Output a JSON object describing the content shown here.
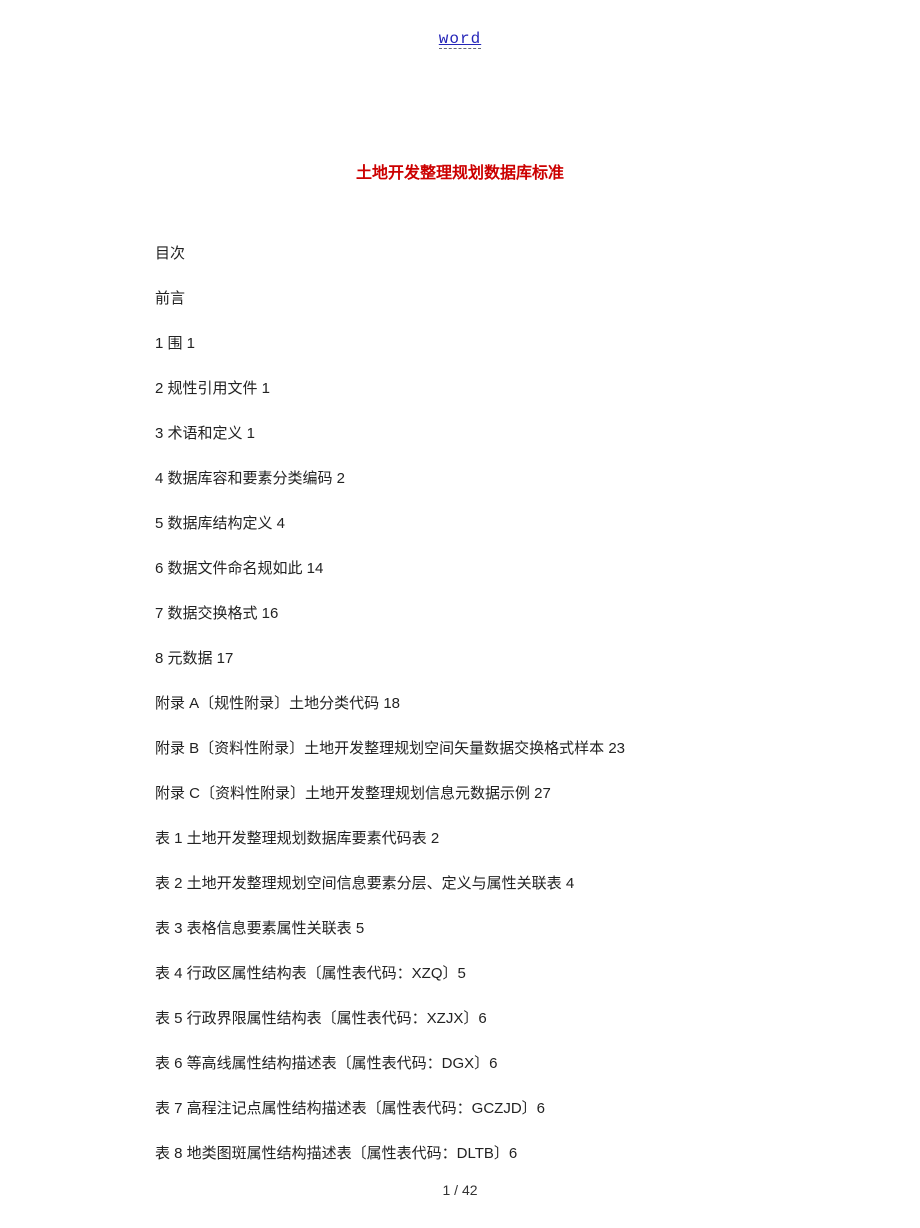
{
  "header": {
    "link": "word"
  },
  "title": "土地开发整理规划数据库标准",
  "toc": [
    "目次",
    "前言",
    "1 围 1",
    "2 规性引用文件 1",
    "3 术语和定义 1",
    "4 数据库容和要素分类编码 2",
    "5 数据库结构定义 4",
    "6 数据文件命名规如此 14",
    "7 数据交换格式 16",
    "8 元数据 17",
    "附录 A〔规性附录〕土地分类代码 18",
    "附录 B〔资料性附录〕土地开发整理规划空间矢量数据交换格式样本 23",
    "附录 C〔资料性附录〕土地开发整理规划信息元数据示例 27",
    "表 1 土地开发整理规划数据库要素代码表 2",
    "表 2 土地开发整理规划空间信息要素分层、定义与属性关联表 4",
    "表 3 表格信息要素属性关联表 5",
    "表 4 行政区属性结构表〔属性表代码：XZQ〕5",
    "表 5 行政界限属性结构表〔属性表代码：XZJX〕6",
    "表 6 等高线属性结构描述表〔属性表代码：DGX〕6",
    "表 7 高程注记点属性结构描述表〔属性表代码：GCZJD〕6",
    "表 8 地类图斑属性结构描述表〔属性表代码：DLTB〕6"
  ],
  "footer": {
    "page": "1 / 42"
  }
}
